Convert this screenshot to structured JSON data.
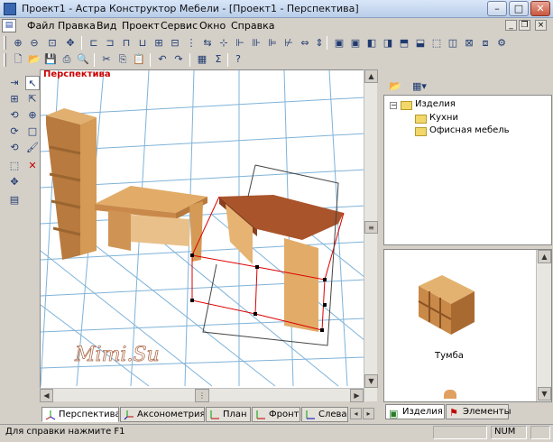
{
  "window": {
    "title": "Проект1 - Астра Конструктор Мебели - [Проект1 - Перспектива]",
    "minimize": "–",
    "maximize": "□",
    "close": "✕"
  },
  "menu": [
    "Файл",
    "Правка",
    "Вид",
    "Проект",
    "Сервис",
    "Окно",
    "Справка"
  ],
  "viewport": {
    "label": "Перспектива",
    "watermark": "Mimi.Su"
  },
  "tabs": [
    "Перспектива",
    "Аксонометрия",
    "План",
    "Фронт",
    "Слева"
  ],
  "tree": {
    "root": "Изделия",
    "children": [
      "Кухни",
      "Офисная мебель"
    ]
  },
  "preview": {
    "item_label": "Тумба"
  },
  "panel_tabs": [
    "Изделия",
    "Элементы"
  ],
  "status": {
    "help": "Для справки нажмите F1",
    "num": "NUM"
  },
  "colors": {
    "accent": "#cc0000",
    "wood": "#d8a15c",
    "grid": "#7fb3d9",
    "title_bg": "#c6d6ee"
  },
  "icons": [
    "zoom-in-icon",
    "zoom-out-icon",
    "pan-icon",
    "new-icon",
    "open-icon",
    "save-icon",
    "print-icon",
    "cut-icon",
    "copy-icon",
    "paste-icon",
    "undo-icon",
    "redo-icon",
    "sigma-icon",
    "help-icon",
    "pointer-icon",
    "rotate-icon",
    "move-icon",
    "delete-icon",
    "folder-icon"
  ]
}
